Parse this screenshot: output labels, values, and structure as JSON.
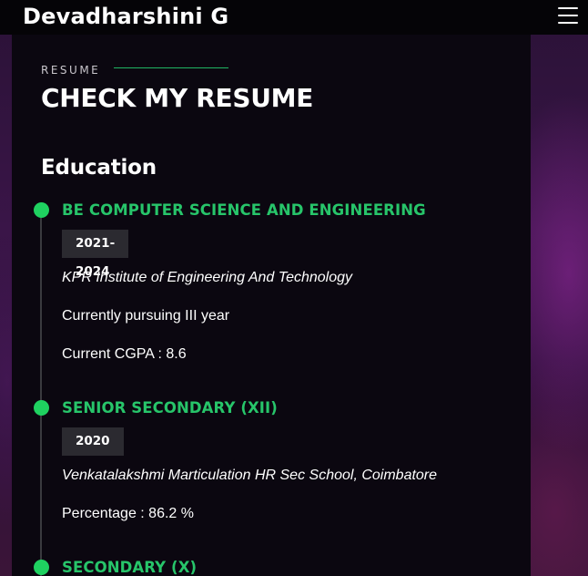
{
  "header": {
    "brand": "Devadharshini G",
    "menu_icon": "hamburger-icon"
  },
  "section": {
    "label": "RESUME",
    "title": "CHECK MY RESUME",
    "group_title": "Education",
    "accent_color": "#27c56a"
  },
  "education": [
    {
      "title": "BE COMPUTER SCIENCE AND ENGINEERING",
      "years": "2021-2024",
      "institution": "KPR Institute of Engineering And Technology",
      "detail_1": "Currently pursuing III year",
      "detail_2": "Current CGPA : 8.6"
    },
    {
      "title": "SENIOR SECONDARY (XII)",
      "years": "2020",
      "institution": "Venkatalakshmi Marticulation HR Sec School, Coimbatore",
      "detail_1": "Percentage : 86.2 %"
    },
    {
      "title": "SECONDARY (X)"
    }
  ]
}
